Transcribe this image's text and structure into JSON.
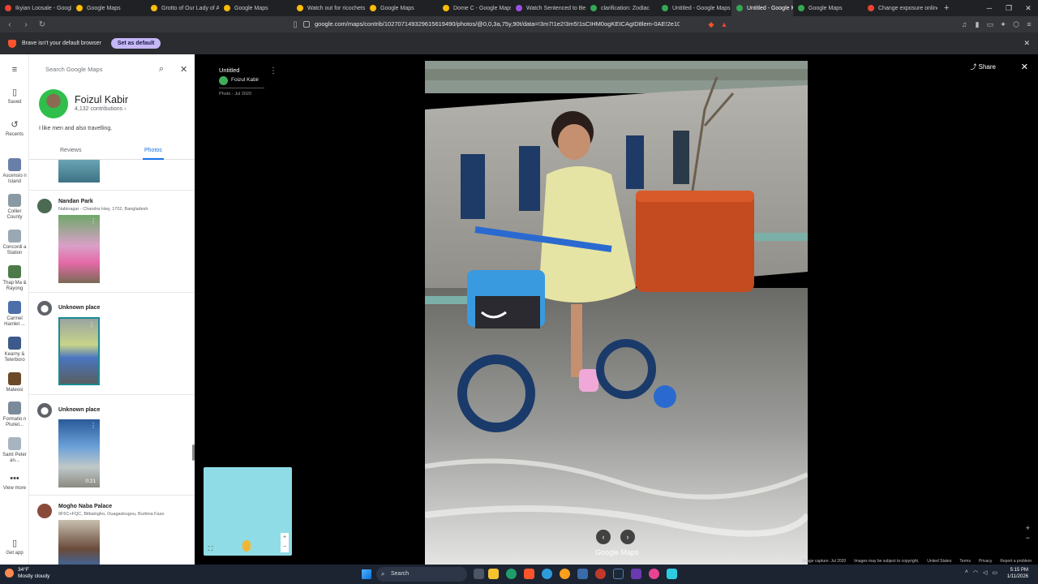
{
  "browser": {
    "tabs": [
      {
        "label": "Ikyian Loosale - Google M",
        "color": "#ea4335",
        "active": false
      },
      {
        "label": "Google Maps",
        "color": "#fbbc04",
        "active": false
      },
      {
        "label": "Grotto of Our Lady of Al",
        "color": "#fbbc04",
        "active": false
      },
      {
        "label": "Google Maps",
        "color": "#fbbc04",
        "active": false
      },
      {
        "label": "Watch out for ricochets a",
        "color": "#fbbc04",
        "active": false
      },
      {
        "label": "Google Maps",
        "color": "#fbbc04",
        "active": false
      },
      {
        "label": "Dome C - Google Maps",
        "color": "#fbbc04",
        "active": false
      },
      {
        "label": "Watch Sentenced to Be",
        "color": "#9b51e0",
        "active": false
      },
      {
        "label": "clarification: Zodiac",
        "color": "#34a853",
        "active": false
      },
      {
        "label": "Untitled - Google Maps",
        "color": "#34a853",
        "active": false
      },
      {
        "label": "Untitled - Google M",
        "color": "#34a853",
        "active": true
      },
      {
        "label": "Google Maps",
        "color": "#34a853",
        "active": false
      },
      {
        "label": "Change exposure online",
        "color": "#ea4335",
        "active": false
      }
    ],
    "new_tab": "+",
    "url": "google.com/maps/contrib/102707149329615619490/photos/@0,0,3a,75y,90t/data=!3m7!1e2!3m5!1sCIHM0ogKEICAgID8lem-0AE!2e10!6shttps...",
    "infobar_message": "Brave isn't your default browser",
    "set_default_label": "Set as default"
  },
  "rail": {
    "menu_icon": "hamburger-icon",
    "items": [
      {
        "label": "Saved",
        "kind": "icon",
        "glyph": "▯",
        "icon": "bookmark-icon"
      },
      {
        "label": "Recents",
        "kind": "icon",
        "glyph": "↺",
        "icon": "history-icon"
      },
      {
        "label": "Ascensio n Island",
        "kind": "thumb",
        "color": "#6a7fa8"
      },
      {
        "label": "Collier County",
        "kind": "thumb",
        "color": "#8a9aa4"
      },
      {
        "label": "Concordi a Station",
        "kind": "thumb",
        "color": "#9aa8b4"
      },
      {
        "label": "Thap Ma & Rayong",
        "kind": "thumb",
        "color": "#4e7a4a"
      },
      {
        "label": "Carmel Hamlet ...",
        "kind": "thumb",
        "color": "#4c6fa8"
      },
      {
        "label": "Kearny & Teterboro",
        "kind": "thumb",
        "color": "#3d5a8a"
      },
      {
        "label": "Mateosi",
        "kind": "thumb",
        "color": "#6b4a2a"
      },
      {
        "label": "Formatio n Pluriel...",
        "kind": "thumb",
        "color": "#7a8a9a"
      },
      {
        "label": "Saint Peter an...",
        "kind": "thumb",
        "color": "#a8b4c0"
      },
      {
        "label": "View more",
        "kind": "icon",
        "glyph": "•••",
        "icon": "more-icon"
      }
    ],
    "get_app": "Get app"
  },
  "panel": {
    "search_placeholder": "Search Google Maps",
    "profile_name": "Foizul Kabir",
    "contributions": "4,132 contributions ›",
    "bio": "I like men and also travelling.",
    "tabs": {
      "reviews": "Reviews",
      "photos": "Photos"
    },
    "entries": [
      {
        "title": "Nandan Park",
        "address": "Nabinagar - Chandra Hwy, 1702, Bangladesh",
        "kind": "avatar"
      },
      {
        "title": "Unknown place",
        "address": "",
        "kind": "pin"
      },
      {
        "title": "Unknown place",
        "address": "",
        "kind": "pin",
        "duration": "0:21"
      },
      {
        "title": "Mogho Naba Palace",
        "address": "9F5C+FQC, Bilbalogho, Ouagadougou, Burkina Faso",
        "kind": "avatar"
      }
    ]
  },
  "viewer": {
    "title": "Untitled",
    "author": "Foizul Kabir",
    "date": "Photo - Jul 2020",
    "share_label": "Share",
    "logo": "Google Maps",
    "footer": [
      "Image capture: Jul 2020",
      "Images may be subject to copyright.",
      "United States",
      "Terms",
      "Privacy",
      "Report a problem"
    ]
  },
  "taskbar": {
    "temp": "34°F",
    "weather": "Mostly cloudy",
    "search": "Search",
    "time": "5:15 PM",
    "date": "1/11/2026"
  }
}
